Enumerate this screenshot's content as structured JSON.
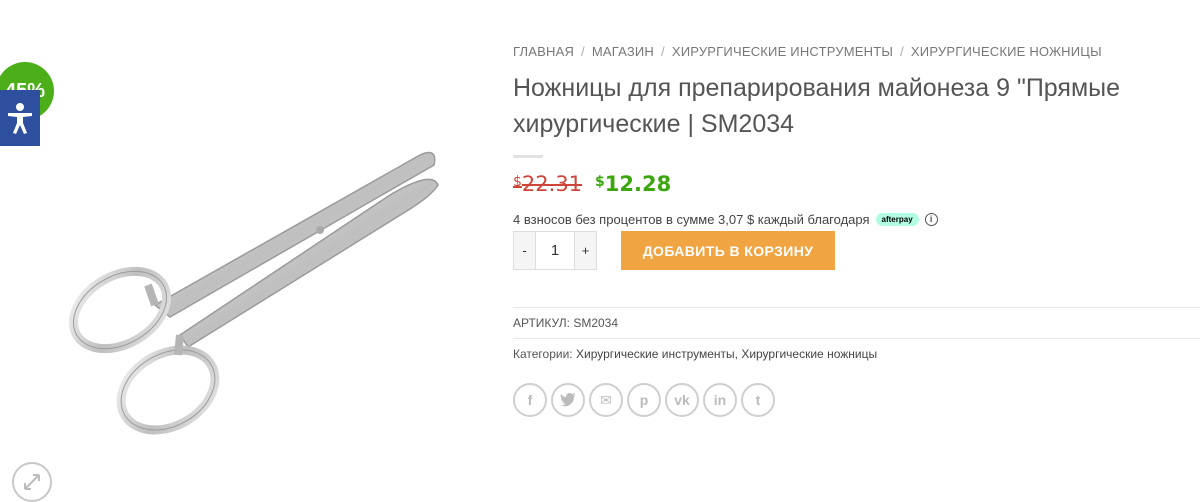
{
  "badge": {
    "sale": "45%"
  },
  "breadcrumb": [
    "ГЛАВНАЯ",
    "МАГАЗИН",
    "ХИРУРГИЧЕСКИЕ ИНСТРУМЕНТЫ",
    "ХИРУРГИЧЕСКИЕ НОЖНИЦЫ"
  ],
  "breadcrumb_sep": "/",
  "product": {
    "title": "Ножницы для препарирования майонеза 9 \"Прямые хирургические | SM2034",
    "currency": "$",
    "old_price": "22.31",
    "new_price": "12.28",
    "installments": "4 взносов без процентов в сумме 3,07 $ каждый благодаря",
    "afterpay": "afterpay",
    "info": "i",
    "qty_minus": "-",
    "qty_value": "1",
    "qty_plus": "+",
    "add_to_cart": "ДОБАВИТЬ В КОРЗИНУ",
    "sku_label": "АРТИКУЛ:",
    "sku": "SM2034",
    "categories_label": "Категории:",
    "categories": [
      "Хирургические инструменты",
      "Хирургические ножницы"
    ]
  },
  "share": {
    "facebook": "f",
    "twitter": "t",
    "email": "✉",
    "pinterest": "p",
    "vk": "vk",
    "linkedin": "in",
    "tumblr": "t"
  },
  "colors": {
    "sale_badge": "#4caf1a",
    "old_price": "#d0453a",
    "new_price": "#3ca60f",
    "cart_button": "#f0a442",
    "accessibility": "#2e4f9e"
  }
}
